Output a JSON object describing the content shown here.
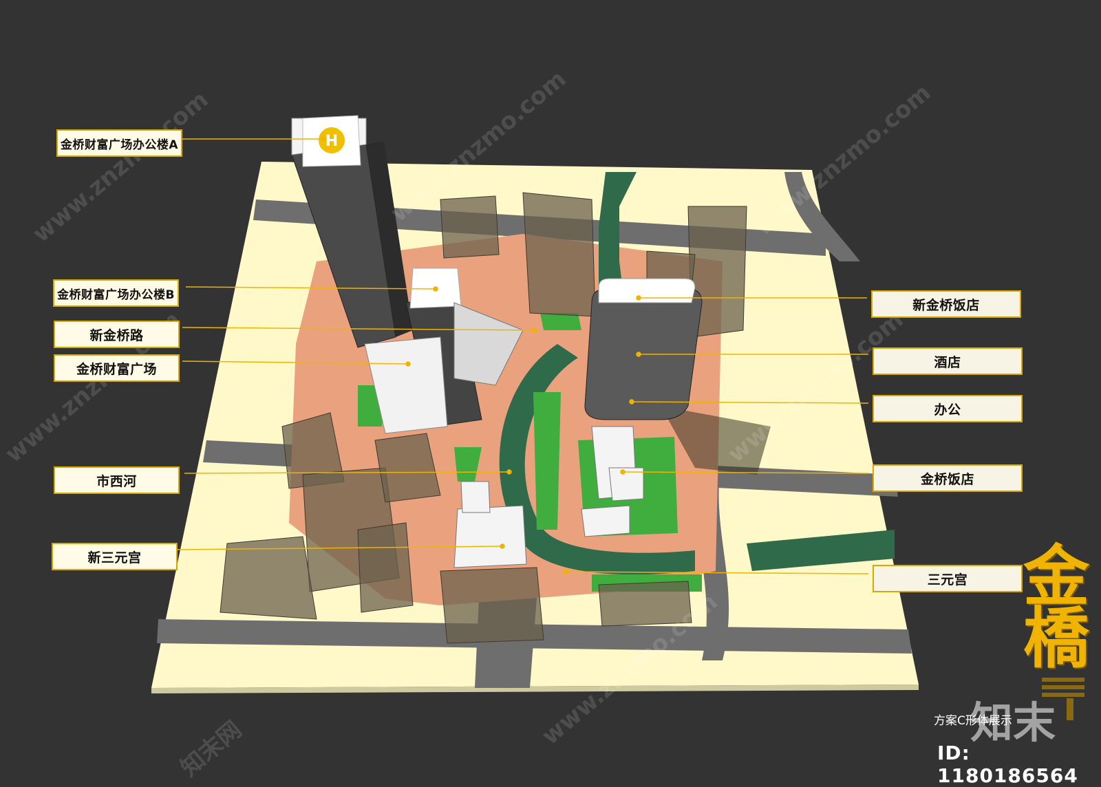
{
  "labels_left": [
    {
      "id": "office-a",
      "text": "金桥财富广场办公楼A"
    },
    {
      "id": "office-b",
      "text": "金桥财富广场办公楼B"
    },
    {
      "id": "new-jinqiao-road",
      "text": "新金桥路"
    },
    {
      "id": "wealth-plaza",
      "text": "金桥财富广场"
    },
    {
      "id": "shixi-river",
      "text": "市西河"
    },
    {
      "id": "new-sanyuan-palace",
      "text": "新三元宫"
    }
  ],
  "labels_right": [
    {
      "id": "new-jinqiao-hotel",
      "text": "新金桥饭店"
    },
    {
      "id": "hotel",
      "text": "酒店"
    },
    {
      "id": "office",
      "text": "办公"
    },
    {
      "id": "jinqiao-hotel",
      "text": "金桥饭店"
    },
    {
      "id": "sanyuan-palace",
      "text": "三元宫"
    }
  ],
  "helipad_letter": "H",
  "brand_chars": [
    "金",
    "橋"
  ],
  "caption": "方案C形体展示",
  "image_id": "ID: 1180186564",
  "watermark": {
    "cn": "知末网",
    "domain": "www.znzmo.com",
    "logo": "知末"
  },
  "colors": {
    "background": "#333333",
    "ground": "#fff8c8",
    "road": "#6e6e6e",
    "plaza": "#e9a27d",
    "river": "#2f6b4a",
    "lawn": "#3fae3f",
    "accent": "#f0b400",
    "label_border": "#d9a800"
  }
}
